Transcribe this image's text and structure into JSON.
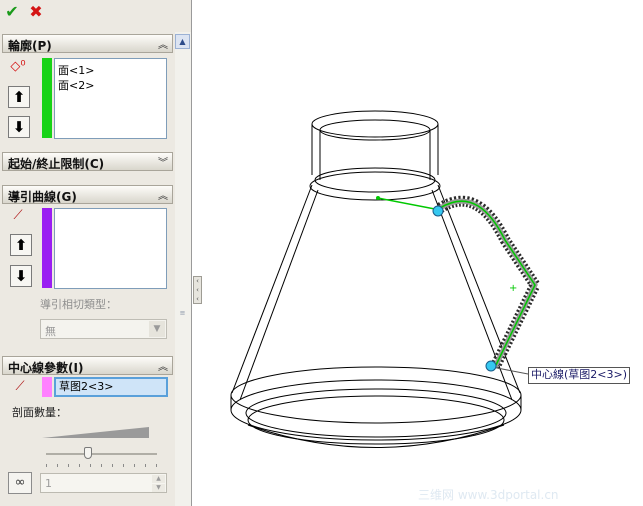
{
  "toolbar": {
    "ok_icon": "checkmark-icon",
    "cancel_icon": "x-icon",
    "ok_glyph": "✔",
    "cancel_glyph": "✖"
  },
  "profile_section": {
    "title": "輪廓(P)",
    "items": [
      "面<1>",
      "面<2>"
    ],
    "color": "#17d317",
    "up_glyph": "⬆",
    "down_glyph": "⬇"
  },
  "start_end_section": {
    "title": "起始/終止限制(C)"
  },
  "guide_section": {
    "title": "導引曲線(G)",
    "color": "#9a1ef2",
    "tangency_label": "導引相切類型：",
    "tangency_value": "無",
    "up_glyph": "⬆",
    "down_glyph": "⬇"
  },
  "centerline_section": {
    "title": "中心線參數(I)",
    "value": "草图2<3>",
    "color": "#ff80ff",
    "sections_label": "剖面數量：",
    "sections_count": "1"
  },
  "viewport": {
    "callout_text": "中心線(草图2<3>)",
    "watermark": "三维网 www.3dportal.cn"
  },
  "colors": {
    "panel_bg": "#ece9e2",
    "highlight": "#5aa0da",
    "path_green": "#00c800",
    "handle_cyan": "#35c8f0"
  }
}
